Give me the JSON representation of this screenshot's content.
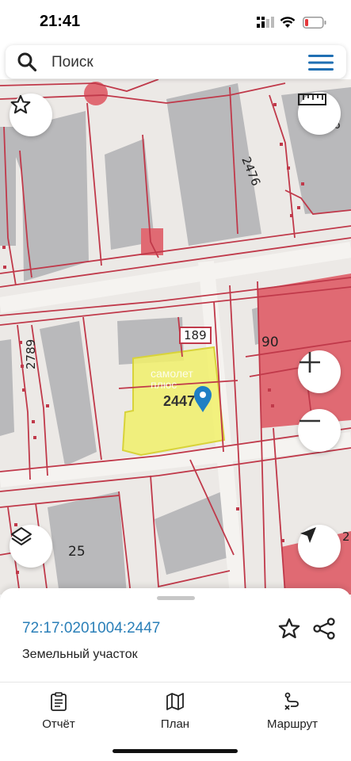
{
  "status_bar": {
    "time": "21:41"
  },
  "search": {
    "placeholder": "Поиск"
  },
  "map": {
    "labels": {
      "parcel_2476": "2476",
      "parcel_189": "189",
      "parcel_90": "90",
      "parcel_2789": "2789",
      "parcel_2447": "2447",
      "parcel_25": "25",
      "edge_right_top": "46",
      "edge_right_bottom": "2"
    },
    "watermark_line1": "самолет",
    "watermark_line2": "плюс",
    "selected_parcel_color": "#f1f06a",
    "boundary_color": "#c0394a",
    "marker_color": "#1f7fc4"
  },
  "sheet": {
    "cadastral_number": "72:17:0201004:2447",
    "object_type": "Земельный участок"
  },
  "tabs": [
    {
      "label": "Отчёт",
      "icon": "report-icon"
    },
    {
      "label": "План",
      "icon": "map-plan-icon"
    },
    {
      "label": "Маршрут",
      "icon": "route-icon"
    }
  ]
}
